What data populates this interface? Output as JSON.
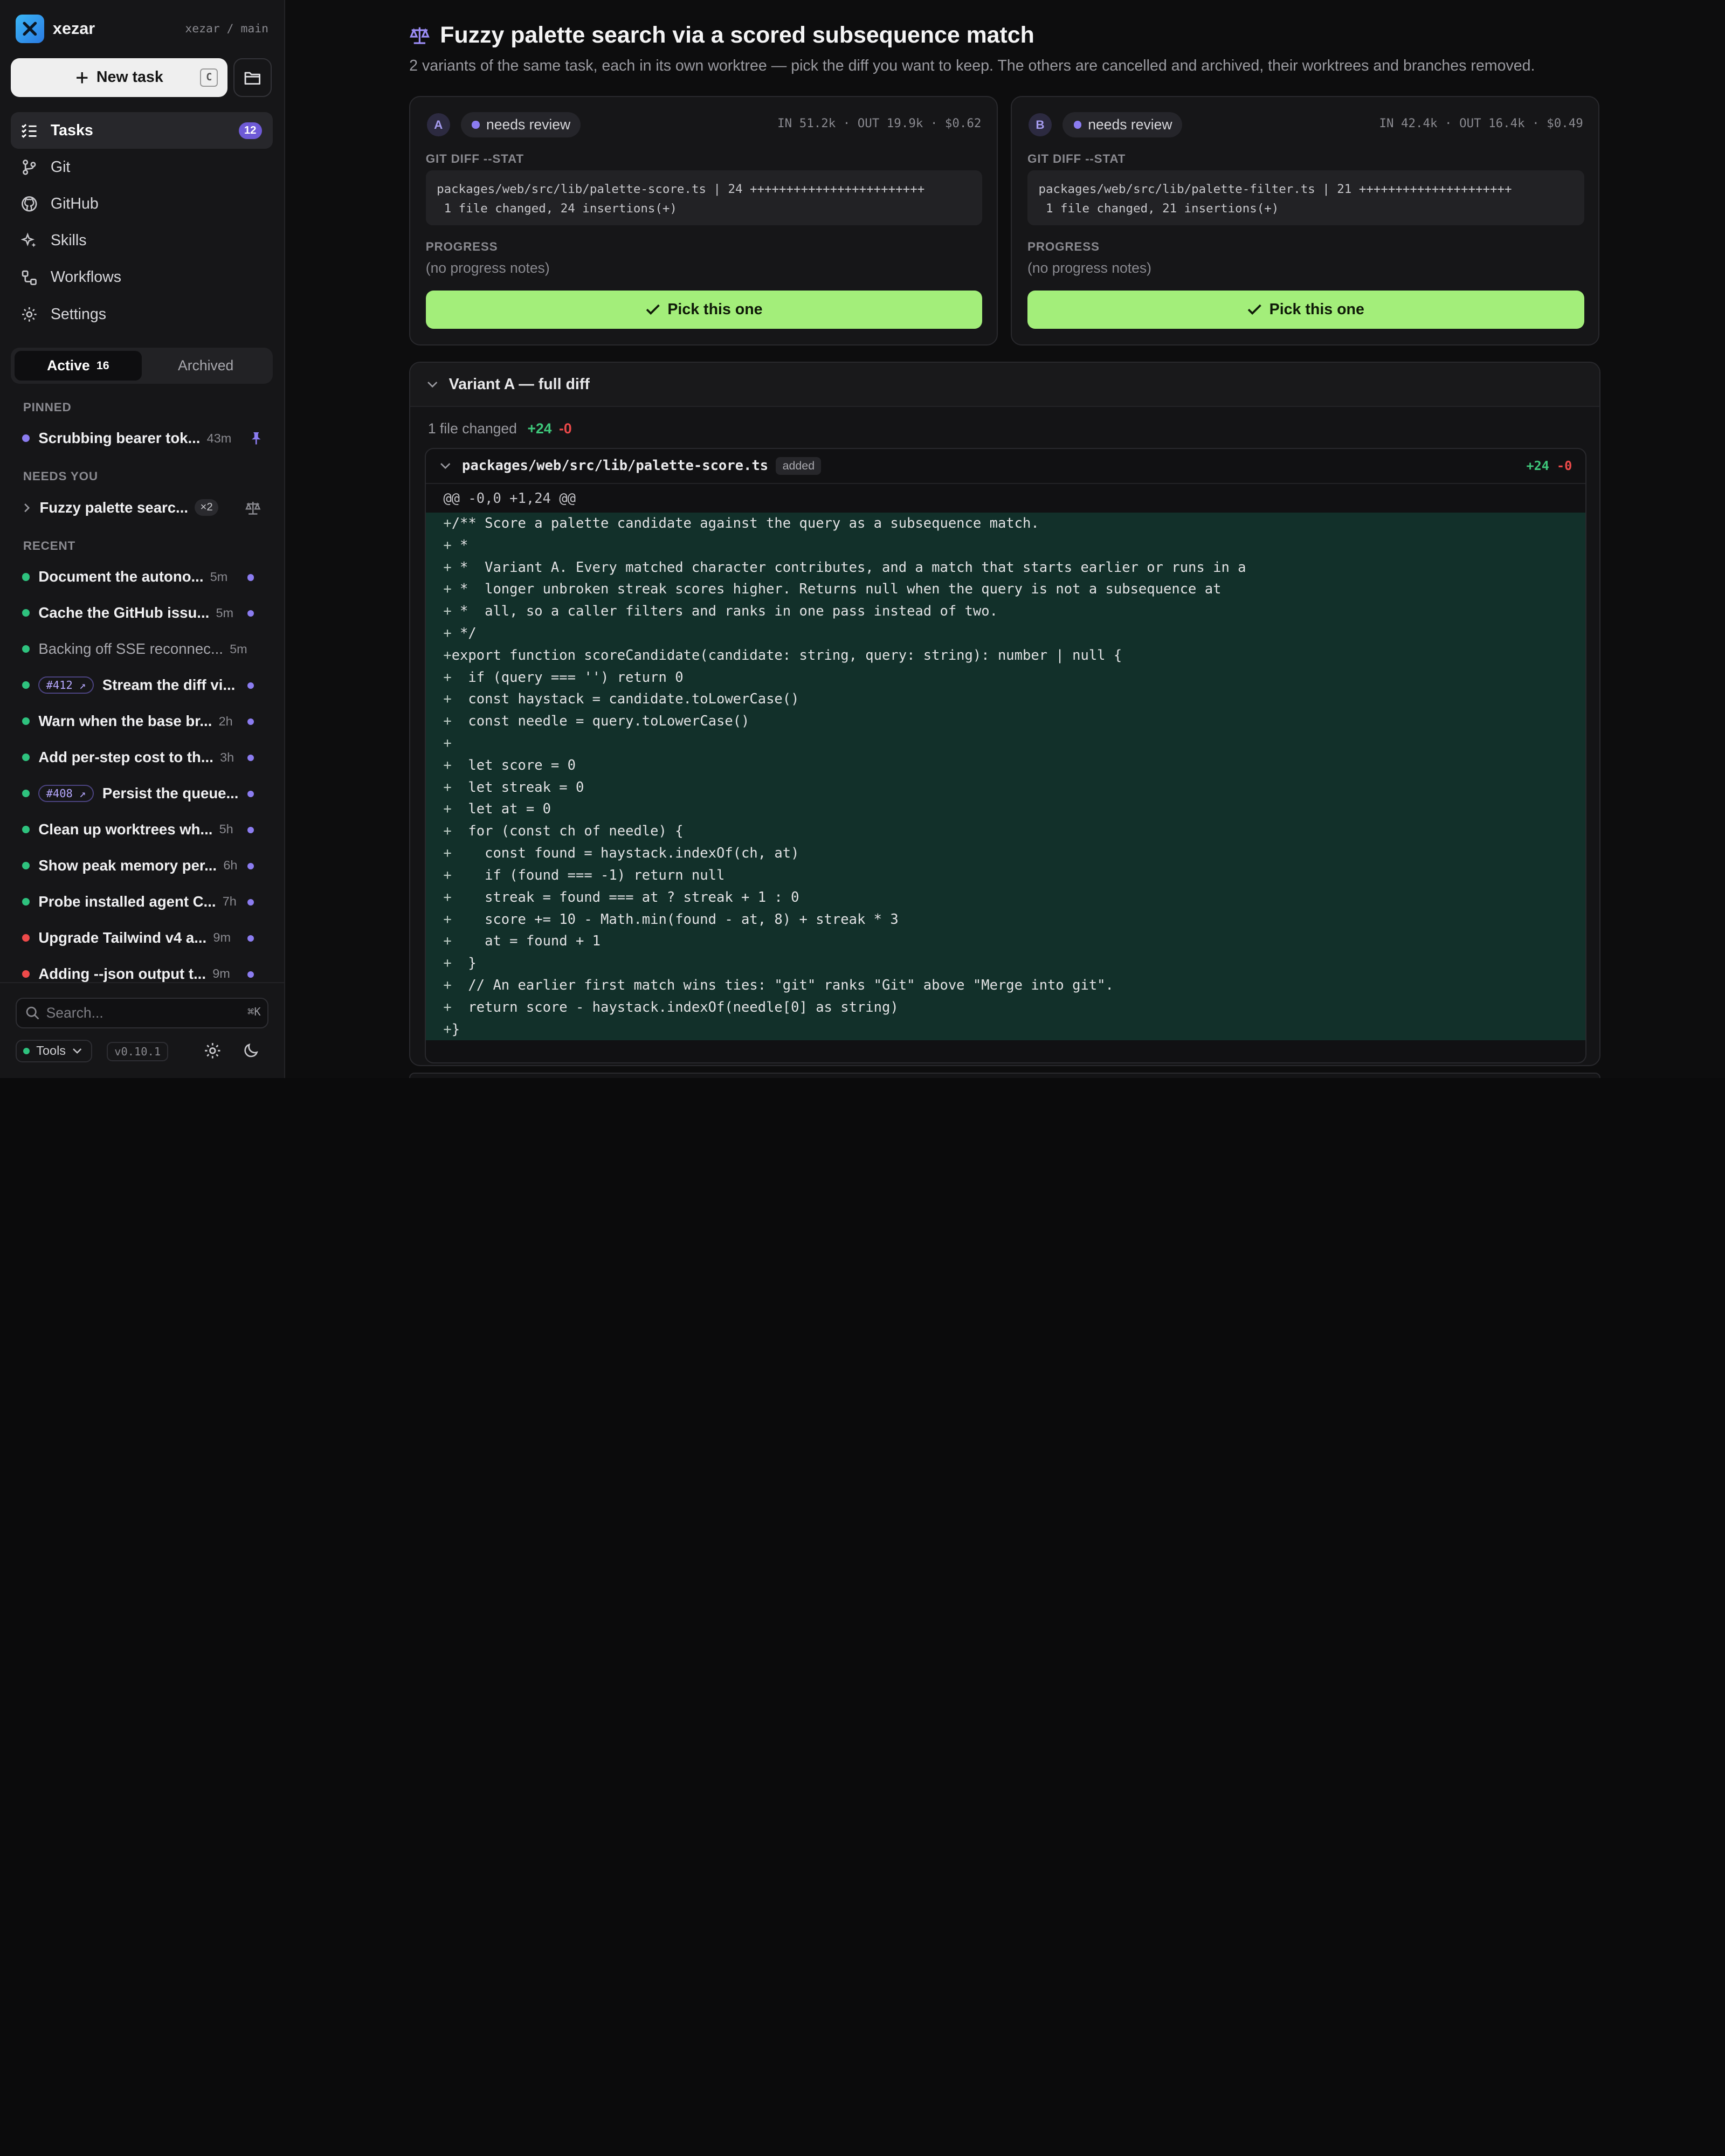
{
  "app": {
    "name": "xezar",
    "repo": "xezar / main"
  },
  "toolbar": {
    "new_task_label": "New task",
    "new_task_shortcut": "C"
  },
  "nav": [
    {
      "label": "Tasks",
      "icon": "tasks-icon",
      "badge": "12"
    },
    {
      "label": "Git",
      "icon": "git-branch-icon"
    },
    {
      "label": "GitHub",
      "icon": "github-icon"
    },
    {
      "label": "Skills",
      "icon": "sparkles-icon"
    },
    {
      "label": "Workflows",
      "icon": "workflows-icon"
    },
    {
      "label": "Settings",
      "icon": "gear-icon"
    }
  ],
  "tabs": {
    "active_label": "Active",
    "active_count": "16",
    "archived_label": "Archived"
  },
  "sections": {
    "pinned": "PINNED",
    "needs_you": "NEEDS YOU",
    "recent": "RECENT"
  },
  "pinned": [
    {
      "title": "Scrubbing bearer tok...",
      "time": "43m",
      "status_color": "#8b7cf0"
    }
  ],
  "needs_you": [
    {
      "title": "Fuzzy palette searc...",
      "count": "×2"
    }
  ],
  "recent": [
    {
      "title": "Document the autono...",
      "time": "5m",
      "status_color": "#2ec27e"
    },
    {
      "title": "Cache the GitHub issu...",
      "time": "5m",
      "status_color": "#2ec27e"
    },
    {
      "title": "Backing off SSE reconnec...",
      "time": "5m",
      "status_color": "#2ec27e"
    },
    {
      "pr": "#412 ↗",
      "title": "Stream the diff vi...",
      "status_color": "#2ec27e"
    },
    {
      "title": "Warn when the base br...",
      "time": "2h",
      "status_color": "#2ec27e"
    },
    {
      "title": "Add per-step cost to th...",
      "time": "3h",
      "status_color": "#2ec27e"
    },
    {
      "pr": "#408 ↗",
      "title": "Persist the queue...",
      "status_color": "#2ec27e"
    },
    {
      "title": "Clean up worktrees wh...",
      "time": "5h",
      "status_color": "#2ec27e"
    },
    {
      "title": "Show peak memory per...",
      "time": "6h",
      "status_color": "#2ec27e"
    },
    {
      "title": "Probe installed agent C...",
      "time": "7h",
      "status_color": "#2ec27e"
    },
    {
      "title": "Upgrade Tailwind v4 a...",
      "time": "9m",
      "status_color": "#ee4a4a"
    },
    {
      "title": "Adding --json output t...",
      "time": "9m",
      "status_color": "#ee4a4a"
    }
  ],
  "search": {
    "placeholder": "Search...",
    "shortcut": "⌘K"
  },
  "footer": {
    "tools_label": "Tools",
    "version": "v0.10.1"
  },
  "page": {
    "title": "Fuzzy palette search via a scored subsequence match",
    "subtitle": "2 variants of the same task, each in its own worktree — pick the diff you want to keep. The others are cancelled and archived, their worktrees and branches removed."
  },
  "variants": [
    {
      "letter": "A",
      "status": "needs review",
      "stats": "IN 51.2k · OUT 19.9k · $0.62",
      "diff_label": "GIT DIFF --STAT",
      "diff_stat": "packages/web/src/lib/palette-score.ts | 24 ++++++++++++++++++++++++\n 1 file changed, 24 insertions(+)",
      "progress_label": "PROGRESS",
      "progress": "(no progress notes)",
      "pick_label": "Pick this one"
    },
    {
      "letter": "B",
      "status": "needs review",
      "stats": "IN 42.4k · OUT 16.4k · $0.49",
      "diff_label": "GIT DIFF --STAT",
      "diff_stat": "packages/web/src/lib/palette-filter.ts | 21 +++++++++++++++++++++\n 1 file changed, 21 insertions(+)",
      "progress_label": "PROGRESS",
      "progress": "(no progress notes)",
      "pick_label": "Pick this one"
    }
  ],
  "full_diff": {
    "title": "Variant A — full diff",
    "summary": "1 file changed",
    "summary_add": "+24",
    "summary_del": "-0",
    "file": "packages/web/src/lib/palette-score.ts",
    "file_badge": "added",
    "file_add": "+24",
    "file_del": "-0",
    "hunk": "@@ -0,0 +1,24 @@",
    "lines": [
      "/** Score a palette candidate against the query as a subsequence match.",
      " *",
      " *  Variant A. Every matched character contributes, and a match that starts earlier or runs in a",
      " *  longer unbroken streak scores higher. Returns null when the query is not a subsequence at",
      " *  all, so a caller filters and ranks in one pass instead of two.",
      " */",
      "export function scoreCandidate(candidate: string, query: string): number | null {",
      "  if (query === '') return 0",
      "  const haystack = candidate.toLowerCase()",
      "  const needle = query.toLowerCase()",
      "",
      "  let score = 0",
      "  let streak = 0",
      "  let at = 0",
      "  for (const ch of needle) {",
      "    const found = haystack.indexOf(ch, at)",
      "    if (found === -1) return null",
      "    streak = found === at ? streak + 1 : 0",
      "    score += 10 - Math.min(found - at, 8) + streak * 3",
      "    at = found + 1",
      "  }",
      "  // An earlier first match wins ties: \"git\" ranks \"Git\" above \"Merge into git\".",
      "  return score - haystack.indexOf(needle[0] as string)",
      "}"
    ]
  }
}
